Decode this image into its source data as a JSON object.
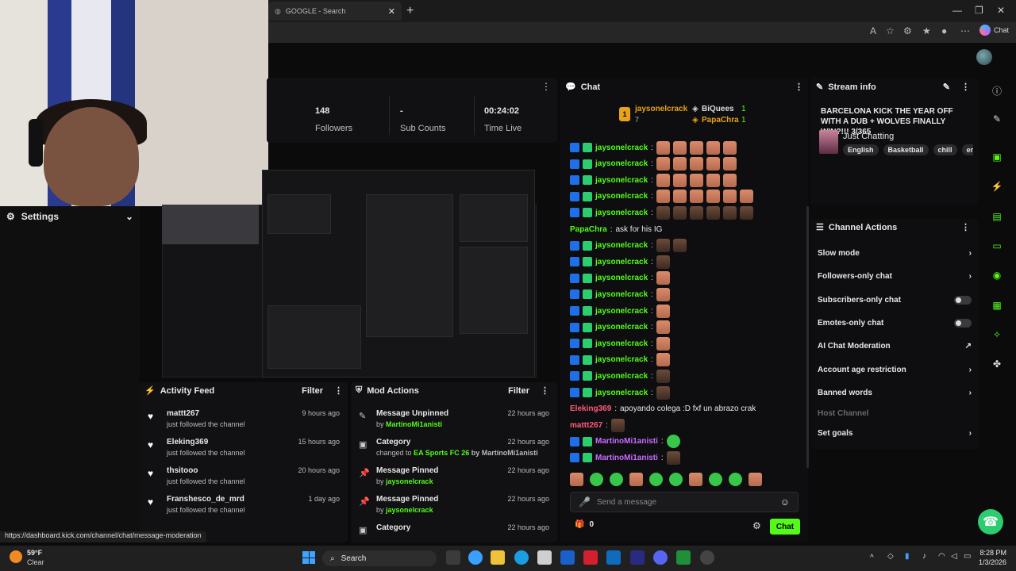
{
  "browser": {
    "tab_title": "GOOGLE - Search",
    "copilot_label": "Chat"
  },
  "settings": {
    "label": "Settings"
  },
  "stats": [
    {
      "value": "148",
      "label": "Followers"
    },
    {
      "value": "-",
      "label": "Sub Counts"
    },
    {
      "value": "00:24:02",
      "label": "Time Live"
    }
  ],
  "activity_feed": {
    "title": "Activity Feed",
    "filter_label": "Filter",
    "items": [
      {
        "name": "mattt267",
        "action": "just followed the channel",
        "time": "9 hours ago"
      },
      {
        "name": "Eleking369",
        "action": "just followed the channel",
        "time": "15 hours ago"
      },
      {
        "name": "thsitooo",
        "action": "just followed the channel",
        "time": "20 hours ago"
      },
      {
        "name": "Franshesco_de_mrd",
        "action": "just followed the channel",
        "time": "1 day ago"
      }
    ]
  },
  "mod_actions": {
    "title": "Mod Actions",
    "filter_label": "Filter",
    "items": [
      {
        "title": "Message Unpinned",
        "prefix": "by",
        "highlight": "MartinoMi1anisti",
        "suffix": "",
        "time": "22 hours ago",
        "icon": "pin-off-icon"
      },
      {
        "title": "Category",
        "prefix": "changed to",
        "highlight": "EA Sports FC 26",
        "suffix": "by MartinoMi1anisti",
        "time": "22 hours ago",
        "icon": "category-icon"
      },
      {
        "title": "Message Pinned",
        "prefix": "by",
        "highlight": "jaysonelcrack",
        "suffix": "",
        "time": "22 hours ago",
        "icon": "pin-icon"
      },
      {
        "title": "Message Pinned",
        "prefix": "by",
        "highlight": "jaysonelcrack",
        "suffix": "",
        "time": "22 hours ago",
        "icon": "pin-icon"
      },
      {
        "title": "Category",
        "prefix": "",
        "highlight": "",
        "suffix": "",
        "time": "22 hours ago",
        "icon": "category-icon"
      }
    ]
  },
  "chat": {
    "title": "Chat",
    "leaderboard": [
      {
        "rank": "1",
        "name": "jaysonelcrack",
        "count": "7"
      },
      {
        "name": "BiQuees",
        "count": "1"
      },
      {
        "name": "PapaChra",
        "count": "1"
      }
    ],
    "messages": [
      {
        "user": "jaysonelcrack",
        "text": "",
        "emotes": 5,
        "kind": "hand",
        "badges": true,
        "color": "green"
      },
      {
        "user": "jaysonelcrack",
        "text": "",
        "emotes": 5,
        "kind": "hand",
        "badges": true,
        "color": "green"
      },
      {
        "user": "jaysonelcrack",
        "text": "",
        "emotes": 5,
        "kind": "hand",
        "badges": true,
        "color": "green"
      },
      {
        "user": "jaysonelcrack",
        "text": "",
        "emotes": 6,
        "kind": "hand",
        "badges": true,
        "color": "green"
      },
      {
        "user": "jaysonelcrack",
        "text": "",
        "emotes": 6,
        "kind": "face",
        "badges": true,
        "color": "green"
      },
      {
        "user": "PapaChra",
        "text": "ask for his IG",
        "emotes": 0,
        "kind": "",
        "badges": false,
        "color": "green"
      },
      {
        "user": "jaysonelcrack",
        "text": "",
        "emotes": 2,
        "kind": "face",
        "badges": true,
        "color": "green"
      },
      {
        "user": "jaysonelcrack",
        "text": "",
        "emotes": 1,
        "kind": "face",
        "badges": true,
        "color": "green"
      },
      {
        "user": "jaysonelcrack",
        "text": "",
        "emotes": 1,
        "kind": "hand",
        "badges": true,
        "color": "green"
      },
      {
        "user": "jaysonelcrack",
        "text": "",
        "emotes": 1,
        "kind": "hand",
        "badges": true,
        "color": "green"
      },
      {
        "user": "jaysonelcrack",
        "text": "",
        "emotes": 1,
        "kind": "hand",
        "badges": true,
        "color": "green"
      },
      {
        "user": "jaysonelcrack",
        "text": "",
        "emotes": 1,
        "kind": "hand",
        "badges": true,
        "color": "green"
      },
      {
        "user": "jaysonelcrack",
        "text": "",
        "emotes": 1,
        "kind": "hand",
        "badges": true,
        "color": "green"
      },
      {
        "user": "jaysonelcrack",
        "text": "",
        "emotes": 1,
        "kind": "hand",
        "badges": true,
        "color": "green"
      },
      {
        "user": "jaysonelcrack",
        "text": "",
        "emotes": 1,
        "kind": "face",
        "badges": true,
        "color": "green"
      },
      {
        "user": "jaysonelcrack",
        "text": "",
        "emotes": 1,
        "kind": "face",
        "badges": true,
        "color": "green"
      },
      {
        "user": "Eleking369",
        "text": "apoyando colega :D fxf un abrazo crak",
        "emotes": 0,
        "kind": "",
        "badges": false,
        "color": "pink"
      },
      {
        "user": "mattt267",
        "text": "",
        "emotes": 1,
        "kind": "face",
        "badges": false,
        "color": "pink"
      },
      {
        "user": "MartinoMi1anisti",
        "text": "",
        "emotes": 1,
        "kind": "g",
        "badges": true,
        "color": "purple"
      },
      {
        "user": "MartinoMi1anisti",
        "text": "",
        "emotes": 1,
        "kind": "face",
        "badges": true,
        "color": "purple"
      }
    ],
    "input_placeholder": "Send a message",
    "points": "0",
    "send_label": "Chat"
  },
  "stream_info": {
    "title": "Stream info",
    "stream_title": "BARCELONA KICK THE YEAR OFF WITH A DUB + WOLVES FINALLY WIN?!!! 3/365",
    "category": "Just Chatting",
    "tags": [
      "English",
      "Basketball",
      "chill",
      "englis"
    ]
  },
  "channel_actions": {
    "title": "Channel Actions",
    "items": [
      {
        "label": "Slow mode",
        "control": "chevron"
      },
      {
        "label": "Followers-only chat",
        "control": "chevron"
      },
      {
        "label": "Subscribers-only chat",
        "control": "toggle"
      },
      {
        "label": "Emotes-only chat",
        "control": "toggle"
      },
      {
        "label": "AI Chat Moderation",
        "control": "external"
      },
      {
        "label": "Account age restriction",
        "control": "chevron"
      },
      {
        "label": "Banned words",
        "control": "chevron"
      },
      {
        "label": "Host Channel",
        "control": "none"
      },
      {
        "label": "Set goals",
        "control": "chevron"
      }
    ]
  },
  "status_url": "https://dashboard.kick.com/channel/chat/message-moderation",
  "taskbar": {
    "weather_temp": "59°F",
    "weather_desc": "Clear",
    "search_label": "Search",
    "time": "8:28 PM",
    "date": "1/3/2026"
  },
  "colors": {
    "accent": "#53fc18",
    "panel": "#111113",
    "background": "#0b0b0c"
  }
}
